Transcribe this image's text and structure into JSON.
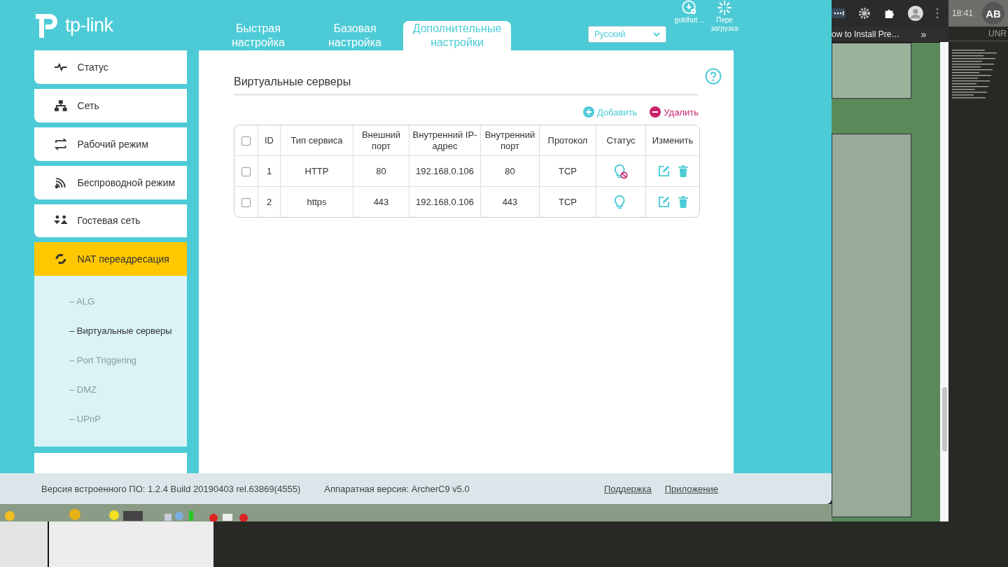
{
  "logo": {
    "text": "tp-link"
  },
  "tabs": [
    {
      "label": "Быстрая настройка",
      "selected": false
    },
    {
      "label": "Базовая настройка",
      "selected": false
    },
    {
      "label": "Дополнительные настройки",
      "selected": true
    }
  ],
  "language": {
    "value": "Русский"
  },
  "header_actions": [
    {
      "label": "goldhot…"
    },
    {
      "label": "Пере загрузка"
    }
  ],
  "sidebar": {
    "items": [
      {
        "label": "Статус",
        "selected": false
      },
      {
        "label": "Сеть",
        "selected": false
      },
      {
        "label": "Рабочий режим",
        "selected": false
      },
      {
        "label": "Беспроводной режим",
        "selected": false
      },
      {
        "label": "Гостевая сеть",
        "selected": false
      },
      {
        "label": "NAT переадресация",
        "selected": true,
        "children": [
          {
            "label": "– ALG",
            "selected": false
          },
          {
            "label": "– Виртуальные серверы",
            "selected": true
          },
          {
            "label": "– Port Triggering",
            "selected": false
          },
          {
            "label": "– DMZ",
            "selected": false
          },
          {
            "label": "– UPnP",
            "selected": false
          }
        ]
      }
    ]
  },
  "content": {
    "title": "Виртуальные серверы",
    "add_label": "Добавить",
    "delete_label": "Удалить",
    "table": {
      "select_all": {
        "checked": false
      },
      "columns": [
        "ID",
        "Тип сервиса",
        "Внешний порт",
        "Внутренний IP-адрес",
        "Внутренний порт",
        "Протокол",
        "Статус",
        "Изменить"
      ],
      "rows": [
        {
          "checked": false,
          "id": "1",
          "service": "HTTP",
          "external_port": "80",
          "internal_ip": "192.168.0.106",
          "internal_port": "80",
          "protocol": "TCP",
          "enabled": false
        },
        {
          "checked": false,
          "id": "2",
          "service": "https",
          "external_port": "443",
          "internal_ip": "192.168.0.106",
          "internal_port": "443",
          "protocol": "TCP",
          "enabled": true
        }
      ]
    }
  },
  "footer": {
    "firmware": "Версия встроенного ПО: 1.2.4 Build 20190403 rel.63869(4555)",
    "hardware": "Аппаратная версия: ArcherC9 v5.0",
    "links": [
      "Поддержка",
      "Приложение"
    ]
  },
  "browser": {
    "tab_title": "ow to Install Pre…",
    "overflow": "»"
  },
  "side_panel": {
    "time": "18:41",
    "avatar": "AB",
    "label": "UNR"
  }
}
